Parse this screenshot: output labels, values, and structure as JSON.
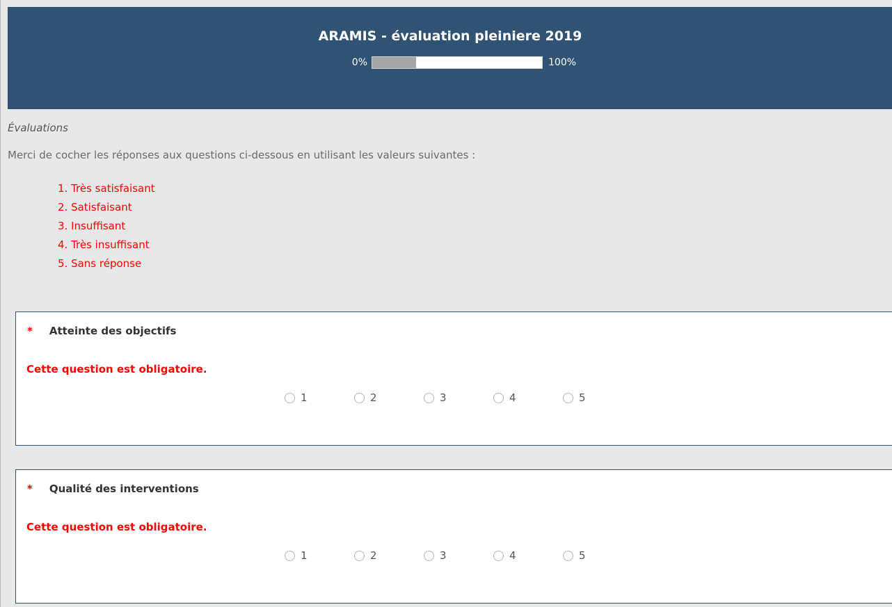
{
  "survey": {
    "title": "ARAMIS - évaluation pleiniere 2019",
    "progress": {
      "min_label": "0%",
      "max_label": "100%",
      "value": 0.26
    }
  },
  "group": {
    "name": "Évaluations",
    "intro": "Merci de cocher les réponses aux questions ci-dessous en utilisant les valeurs suivantes :",
    "scale": [
      "1. Très satisfaisant",
      "2. Satisfaisant",
      "3. Insuffisant",
      "4. Très insuffisant",
      "5. Sans réponse"
    ]
  },
  "questions": [
    {
      "required_marker": "*",
      "title": "Atteinte des objectifs",
      "mandatory_message": "Cette question est obligatoire.",
      "options": [
        "1",
        "2",
        "3",
        "4",
        "5"
      ]
    },
    {
      "required_marker": "*",
      "title": "Qualité des interventions",
      "mandatory_message": "Cette question est obligatoire.",
      "options": [
        "1",
        "2",
        "3",
        "4",
        "5"
      ]
    }
  ],
  "colors": {
    "header_bg": "#305273",
    "page_bg": "#e8e8e8",
    "accent_red": "#ff0000"
  }
}
